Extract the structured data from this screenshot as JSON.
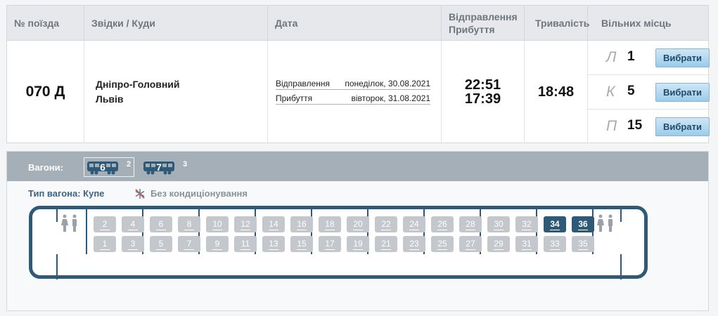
{
  "table": {
    "headers": {
      "number": "№ поїзда",
      "route": "Звідки / Куди",
      "date": "Дата",
      "times_line1": "Відправлення",
      "times_line2": "Прибуття",
      "duration": "Тривалість",
      "seats": "Вільних місць"
    },
    "train": {
      "number": "070 Д",
      "from": "Дніпро-Головний",
      "to": "Львів",
      "departure_label": "Відправлення",
      "departure_date": "понеділок, 30.08.2021",
      "arrival_label": "Прибуття",
      "arrival_date": "вівторок, 31.08.2021",
      "departure_time": "22:51",
      "arrival_time": "17:39",
      "duration": "18:48"
    },
    "seat_classes": [
      {
        "code": "Л",
        "count": "1",
        "button": "Вибрати"
      },
      {
        "code": "К",
        "count": "5",
        "button": "Вибрати"
      },
      {
        "code": "П",
        "count": "15",
        "button": "Вибрати"
      }
    ]
  },
  "wagons": {
    "label": "Вагони:",
    "items": [
      {
        "number": "6",
        "free": "2",
        "selected": true
      },
      {
        "number": "7",
        "free": "3",
        "selected": false
      }
    ],
    "type_label": "Тип вагона: Купе",
    "ac_text": "Без кондиціонування",
    "ac_icon": "no-ac-icon",
    "wc_icon": "restroom-icon"
  },
  "scheme": {
    "top_seats": [
      "2",
      "4",
      "6",
      "8",
      "10",
      "12",
      "14",
      "16",
      "18",
      "20",
      "22",
      "24",
      "26",
      "28",
      "30",
      "32",
      "34",
      "36"
    ],
    "bottom_seats": [
      "1",
      "3",
      "5",
      "7",
      "9",
      "11",
      "13",
      "15",
      "17",
      "19",
      "21",
      "23",
      "25",
      "27",
      "29",
      "31",
      "33",
      "35"
    ],
    "free_seats": [
      "34",
      "36"
    ]
  },
  "colors": {
    "accent": "#2e5a77",
    "seat_taken": "#c4c8cc",
    "bar": "#a4afb8",
    "button": "#9ccbea"
  }
}
